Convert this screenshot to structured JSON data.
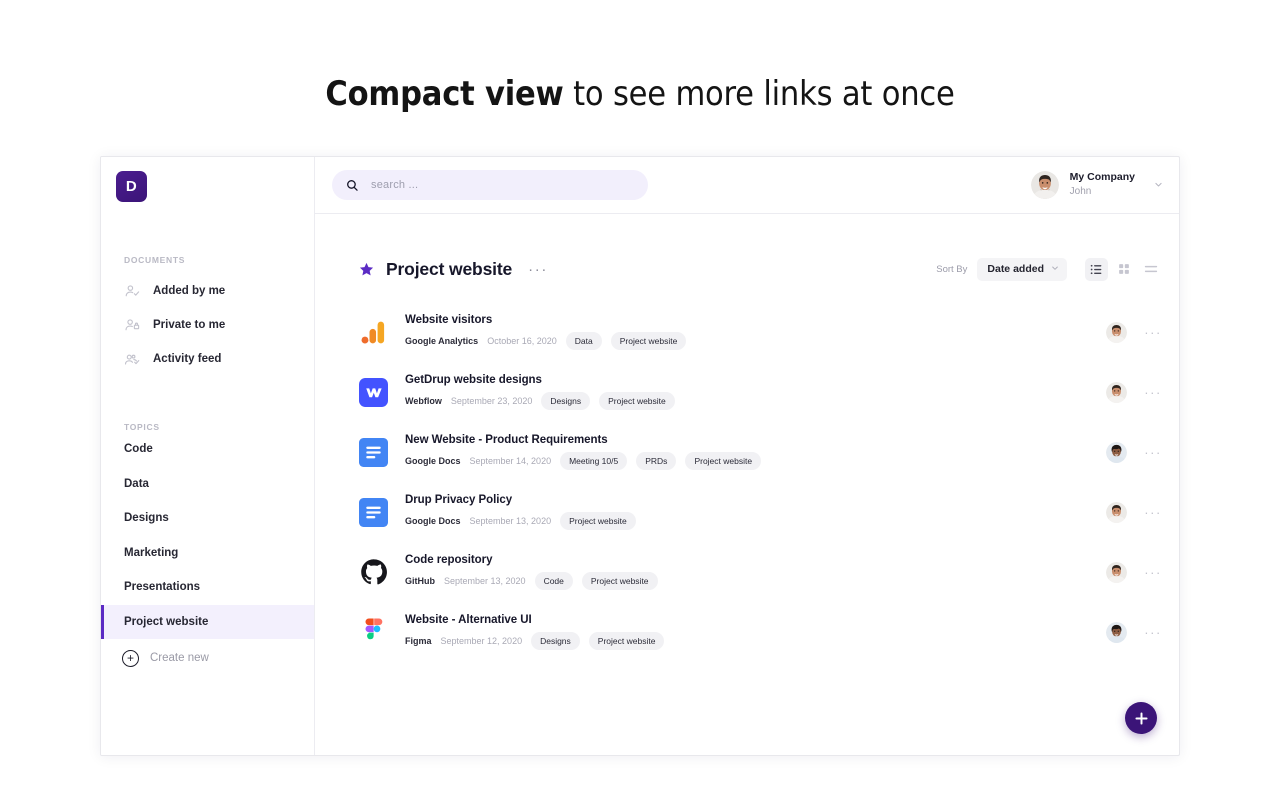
{
  "heading": {
    "bold_part": "Compact view",
    "rest_part": " to see more links at once"
  },
  "colors": {
    "brand_purple": "#3b1478",
    "accent_purple": "#5b2bc4",
    "active_bg": "#f3f0fd",
    "search_bg": "#f2effc",
    "tag_bg": "#f1f1f4"
  },
  "sidebar": {
    "logo_letter": "D",
    "sections": [
      {
        "label": "DOCUMENTS",
        "items": [
          {
            "label": "Added by me",
            "icon": "person-check-icon"
          },
          {
            "label": "Private to me",
            "icon": "person-lock-icon"
          },
          {
            "label": "Activity feed",
            "icon": "people-check-icon"
          }
        ]
      },
      {
        "label": "TOPICS",
        "items": [
          {
            "label": "Code",
            "active": false
          },
          {
            "label": "Data",
            "active": false
          },
          {
            "label": "Designs",
            "active": false
          },
          {
            "label": "Marketing",
            "active": false
          },
          {
            "label": "Presentations",
            "active": false
          },
          {
            "label": "Project website",
            "active": true
          }
        ]
      }
    ],
    "create_new_label": "Create new"
  },
  "topbar": {
    "search_placeholder": "search ...",
    "search_value": "",
    "user": {
      "company": "My Company",
      "name": "John"
    }
  },
  "content_header": {
    "title": "Project website",
    "starred": true,
    "more_label": "···",
    "sort_by_label": "Sort By",
    "sort_value": "Date added",
    "sort_options": [
      "Date added"
    ],
    "views": [
      {
        "name": "list-view",
        "active": true
      },
      {
        "name": "grid-view",
        "active": false
      },
      {
        "name": "compact-view",
        "active": false
      }
    ]
  },
  "documents": [
    {
      "title": "Website visitors",
      "source": "Google Analytics",
      "date": "October 16, 2020",
      "tags": [
        "Data",
        "Project website"
      ],
      "icon": "google-analytics-icon",
      "avatar": "man"
    },
    {
      "title": "GetDrup website designs",
      "source": "Webflow",
      "date": "September 23, 2020",
      "tags": [
        "Designs",
        "Project website"
      ],
      "icon": "webflow-icon",
      "avatar": "man"
    },
    {
      "title": "New Website - Product Requirements",
      "source": "Google Docs",
      "date": "September 14, 2020",
      "tags": [
        "Meeting 10/5",
        "PRDs",
        "Project website"
      ],
      "icon": "google-docs-icon",
      "avatar": "woman"
    },
    {
      "title": "Drup Privacy Policy",
      "source": "Google Docs",
      "date": "September 13, 2020",
      "tags": [
        "Project website"
      ],
      "icon": "google-docs-icon",
      "avatar": "man"
    },
    {
      "title": "Code repository",
      "source": "GitHub",
      "date": "September 13, 2020",
      "tags": [
        "Code",
        "Project website"
      ],
      "icon": "github-icon",
      "avatar": "man"
    },
    {
      "title": "Website - Alternative UI",
      "source": "Figma",
      "date": "September 12, 2020",
      "tags": [
        "Designs",
        "Project website"
      ],
      "icon": "figma-icon",
      "avatar": "woman"
    }
  ],
  "fab": {
    "label": "+"
  },
  "row_more_label": "···"
}
